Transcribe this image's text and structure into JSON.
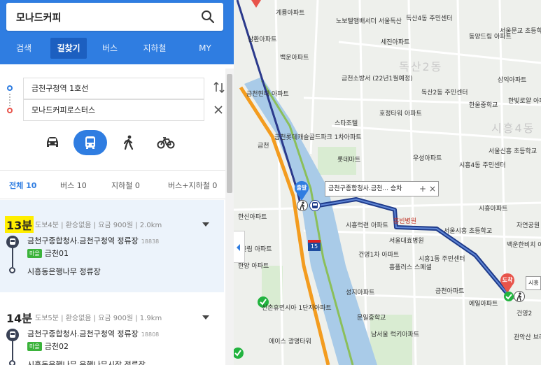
{
  "search": {
    "query": "모나드커피"
  },
  "nav": {
    "tabs": [
      "검색",
      "길찾기",
      "버스",
      "지하철",
      "MY"
    ],
    "active": "길찾기"
  },
  "route": {
    "start": "금천구청역 1호선",
    "end": "모나드커피로스터스"
  },
  "modes": {
    "icons": [
      "car-icon",
      "bus-icon",
      "walk-icon",
      "bike-icon"
    ],
    "active": "bus-icon"
  },
  "filters": [
    {
      "label": "전체",
      "count": "10"
    },
    {
      "label": "버스",
      "count": "10"
    },
    {
      "label": "지하철",
      "count": "0"
    },
    {
      "label": "버스+지하철",
      "count": "0"
    }
  ],
  "results": [
    {
      "time": "13분",
      "meta": "도보4분 | 환승없음 | 요금 900원 | 2.0km",
      "board_stop": "금천구종합청사.금천구청역 정류장",
      "board_stop_id": "18838",
      "bus_badge": "마을",
      "bus_no": "금천01",
      "alight_stop": "시흥동은행나무 정류장"
    },
    {
      "time": "14분",
      "meta": "도보5분 | 환승없음 | 요금 900원 | 1.9km",
      "board_stop": "금천구종합청사.금천구청역 정류장",
      "board_stop_id": "18808",
      "bus_badge": "마을",
      "bus_no": "금천02",
      "alight_stop": "시흥동은행나무 은행나무시장 정류장"
    }
  ],
  "map": {
    "popup": {
      "text": "금천구종합청사.금천... 승차"
    },
    "pins": {
      "start": "출발",
      "end": "도착"
    },
    "road_badge": "15",
    "cut_label": "시흥",
    "labels": [
      "계룡아파트",
      "노보텔앰배서더 서울독산",
      "독산4동 주민센터",
      "서울문교 초등학교",
      "동양드림 아파트",
      "삼환아파트",
      "세진아파트",
      "백운아파트",
      "독산2동",
      "금천소방서 (22년1월예정)",
      "삼익아파트",
      "금천현대 아파트",
      "독산2동 주민센터",
      "한울중학교",
      "한빛로얄 아파트",
      "호정타워 아파트",
      "스타조텔",
      "시흥4동",
      "금천롯데캐슬골드파크 1차아파트",
      "서울신흥 초등학교",
      "롯데마트",
      "우성아파트",
      "시흥4동 주민센터",
      "시흥아파트",
      "한신아파트",
      "시흥럭련 아파트",
      "흥빈병원",
      "서울시흥 초등학교",
      "서울대효병원",
      "백운한비치 아파트",
      "건영1차 아파트",
      "시흥1동 주민센터",
      "흥플러스 스페셜",
      "한양 아파트",
      "금천아파트",
      "성지아파트",
      "에일아파트",
      "문일중학교",
      "신촌휴먼시아 1단지아파트",
      "남서울 럭키아파트",
      "에이스 광명타워",
      "관악산 브래뉴",
      "건영2",
      "자연공원",
      "어울림 아파트",
      "금천"
    ]
  }
}
